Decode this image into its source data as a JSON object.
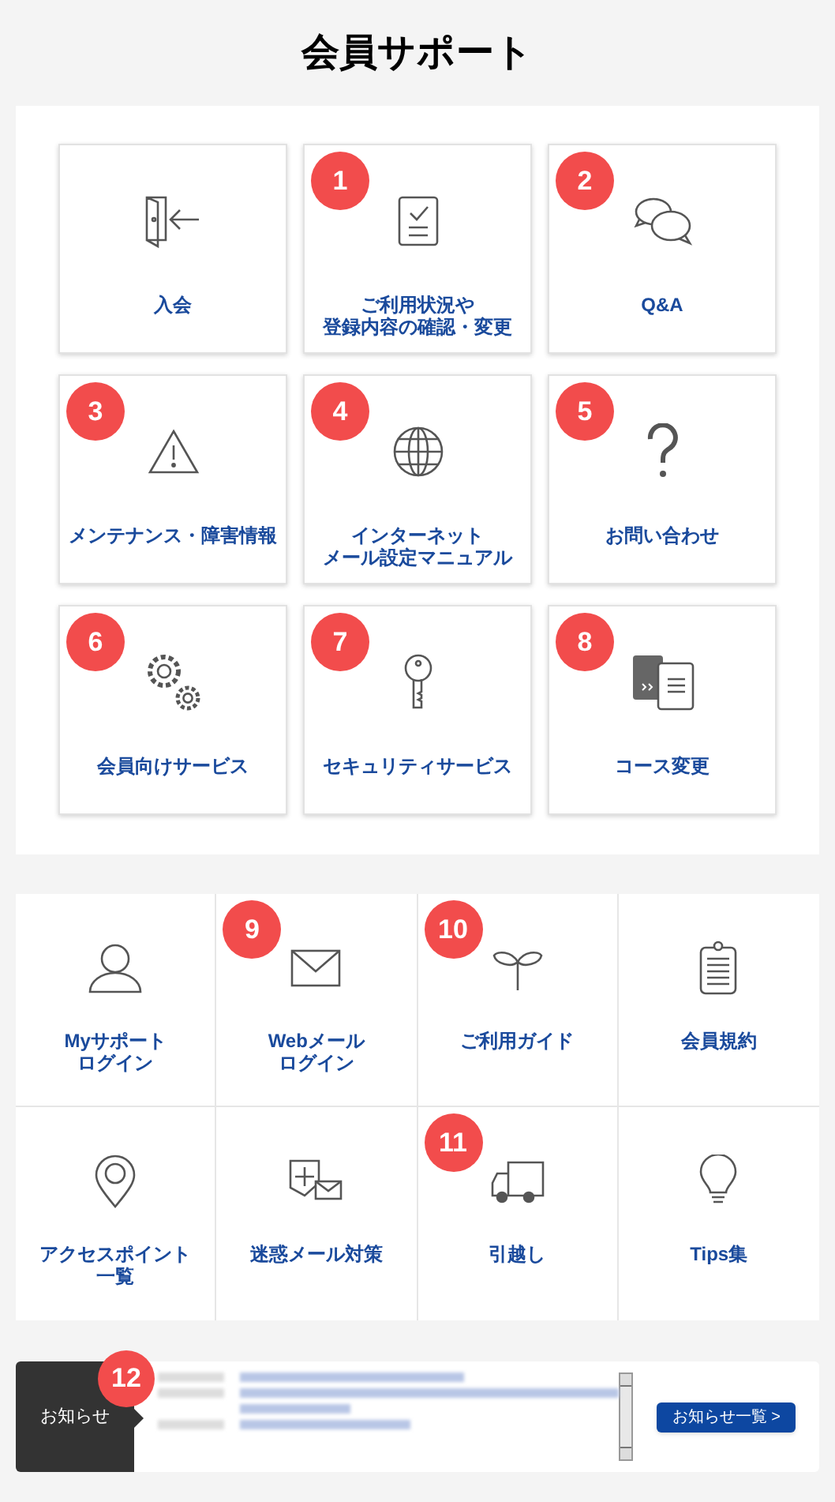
{
  "title": "会員サポート",
  "main_cards": [
    {
      "label": "入会"
    },
    {
      "label": [
        "ご利用状況や",
        "登録内容の確認・変更"
      ],
      "badge": "1"
    },
    {
      "label": "Q&A",
      "badge": "2"
    },
    {
      "label": "メンテナンス・障害情報",
      "badge": "3"
    },
    {
      "label": [
        "インターネット",
        "メール設定マニュアル"
      ],
      "badge": "4"
    },
    {
      "label": "お問い合わせ",
      "badge": "5"
    },
    {
      "label": "会員向けサービス",
      "badge": "6"
    },
    {
      "label": "セキュリティサービス",
      "badge": "7"
    },
    {
      "label": "コース変更",
      "badge": "8"
    }
  ],
  "links": [
    {
      "label": [
        "Myサポート",
        "ログイン"
      ]
    },
    {
      "label": [
        "Webメール",
        "ログイン"
      ],
      "badge": "9"
    },
    {
      "label": "ご利用ガイド",
      "badge": "10"
    },
    {
      "label": "会員規約"
    },
    {
      "label": [
        "アクセスポイント",
        "一覧"
      ]
    },
    {
      "label": "迷惑メール対策"
    },
    {
      "label": "引越し",
      "badge": "11"
    },
    {
      "label": "Tips集"
    }
  ],
  "news": {
    "heading": "お知らせ",
    "badge": "12",
    "button": "お知らせ一覧 >"
  }
}
